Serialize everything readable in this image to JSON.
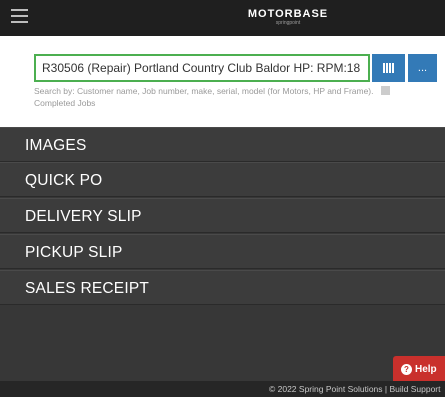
{
  "topbar": {
    "logo_text": "MOTORBASE",
    "logo_sub": "springpoint"
  },
  "search": {
    "value": "R30506 (Repair) Portland Country Club Baldor HP: RPM:18",
    "more_label": "...",
    "hint_text": "Search by: Customer name, Job number, make, serial, model (for Motors, HP and Frame).",
    "completed_jobs_label": "Completed Jobs"
  },
  "menu": {
    "items": [
      {
        "label": "IMAGES"
      },
      {
        "label": "QUICK PO"
      },
      {
        "label": "DELIVERY SLIP"
      },
      {
        "label": "PICKUP SLIP"
      },
      {
        "label": "SALES RECEIPT"
      }
    ]
  },
  "help": {
    "label": "Help"
  },
  "footer": {
    "text": "© 2022 Spring Point Solutions | Build Support"
  },
  "colors": {
    "topbar": "#1f1f1f",
    "menu_bg": "#373737",
    "accent_blue": "#337ab7",
    "input_border": "#4caf50",
    "help_red": "#c9302c"
  }
}
